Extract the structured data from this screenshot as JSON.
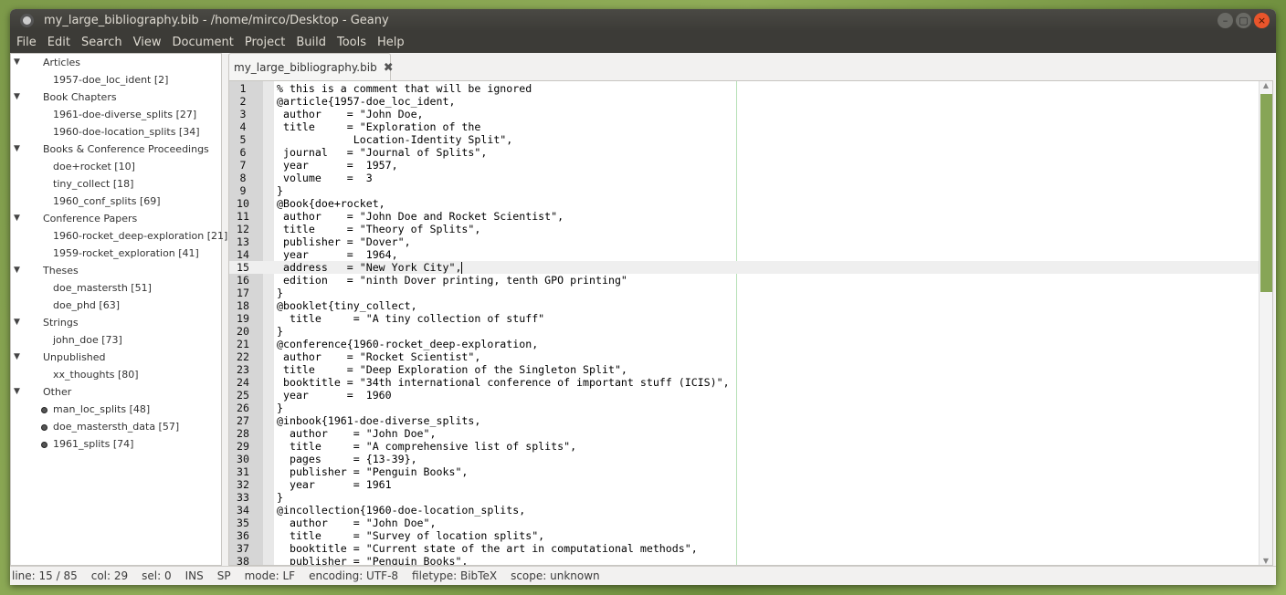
{
  "window": {
    "title": "my_large_bibliography.bib - /home/mirco/Desktop - Geany",
    "minimize": "–",
    "maximize": "▢",
    "close": "×"
  },
  "menu": [
    "File",
    "Edit",
    "Search",
    "View",
    "Document",
    "Project",
    "Build",
    "Tools",
    "Help"
  ],
  "sidebar": {
    "groups": [
      {
        "label": "Articles",
        "items": [
          "1957-doe_loc_ident [2]"
        ]
      },
      {
        "label": "Book Chapters",
        "items": [
          "1961-doe-diverse_splits [27]",
          "1960-doe-location_splits [34]"
        ]
      },
      {
        "label": "Books & Conference Proceedings",
        "items": [
          "doe+rocket [10]",
          "tiny_collect [18]",
          "1960_conf_splits [69]"
        ]
      },
      {
        "label": "Conference Papers",
        "items": [
          "1960-rocket_deep-exploration [21]",
          "1959-rocket_exploration [41]"
        ]
      },
      {
        "label": "Theses",
        "items": [
          "doe_mastersth [51]",
          "doe_phd [63]"
        ]
      },
      {
        "label": "Strings",
        "items": [
          "john_doe [73]"
        ]
      },
      {
        "label": "Unpublished",
        "items": [
          "xx_thoughts [80]"
        ]
      },
      {
        "label": "Other",
        "items": [
          "man_loc_splits [48]",
          "doe_mastersth_data [57]",
          "1961_splits [74]"
        ],
        "icon": "symbol-dot-icon"
      }
    ]
  },
  "tab": {
    "label": "my_large_bibliography.bib",
    "close": "✖"
  },
  "editor": {
    "current_line": 15,
    "lines": [
      "% this is a comment that will be ignored",
      "@article{1957-doe_loc_ident,",
      " author    = \"John Doe,",
      " title     = \"Exploration of the ",
      "            Location-Identity Split\",",
      " journal   = \"Journal of Splits\",",
      " year      =  1957,",
      " volume    =  3",
      "}",
      "@Book{doe+rocket,",
      " author    = \"John Doe and Rocket Scientist\",",
      " title     = \"Theory of Splits\",",
      " publisher = \"Dover\",",
      " year      =  1964,",
      " address   = \"New York City\",",
      " edition   = \"ninth Dover printing, tenth GPO printing\"",
      "}",
      "@booklet{tiny_collect,",
      "  title     = \"A tiny collection of stuff\"",
      "}",
      "@conference{1960-rocket_deep-exploration,",
      " author    = \"Rocket Scientist\",",
      " title     = \"Deep Exploration of the Singleton Split\",",
      " booktitle = \"34th international conference of important stuff (ICIS)\",",
      " year      =  1960",
      "}",
      "@inbook{1961-doe-diverse_splits,",
      "  author    = \"John Doe\",",
      "  title     = \"A comprehensive list of splits\",",
      "  pages     = {13-39},",
      "  publisher = \"Penguin Books\",",
      "  year      = 1961",
      "}",
      "@incollection{1960-doe-location_splits,",
      "  author    = \"John Doe\",",
      "  title     = \"Survey of location splits\",",
      "  booktitle = \"Current state of the art in computational methods\",",
      "  publisher = \"Penguin Books\","
    ]
  },
  "status": {
    "line": "line: 15 / 85",
    "col": "col: 29",
    "sel": "sel: 0",
    "ins": "INS",
    "sp": "SP",
    "mode": "mode: LF",
    "encoding": "encoding: UTF-8",
    "filetype": "filetype: BibTeX",
    "scope": "scope: unknown"
  },
  "colors": {
    "accent": "#87a556",
    "close_button": "#e9552b",
    "titlebar": "#3c3b37"
  }
}
